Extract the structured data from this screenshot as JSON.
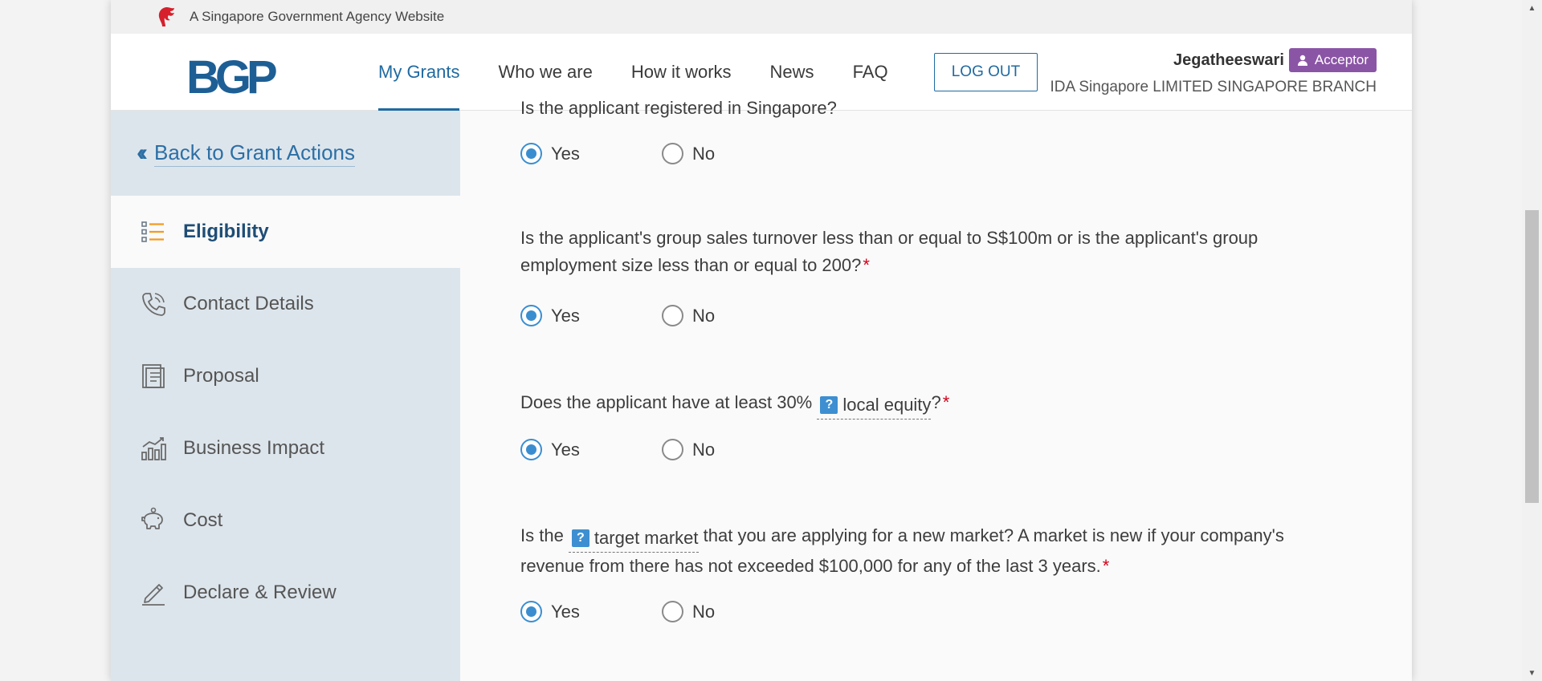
{
  "masthead": {
    "text": "A Singapore Government Agency Website"
  },
  "header": {
    "logo": "BGP",
    "nav": [
      {
        "label": "My Grants",
        "active": true
      },
      {
        "label": "Who we are",
        "active": false
      },
      {
        "label": "How it works",
        "active": false
      },
      {
        "label": "News",
        "active": false
      },
      {
        "label": "FAQ",
        "active": false
      }
    ],
    "logout_label": "LOG OUT",
    "user_name": "Jegatheeswari",
    "role": "Acceptor",
    "org": "IDA Singapore LIMITED SINGAPORE BRANCH"
  },
  "sidebar": {
    "back_label": "Back to Grant Actions",
    "items": [
      {
        "label": "Eligibility",
        "icon": "list-icon",
        "active": true
      },
      {
        "label": "Contact Details",
        "icon": "phone-icon",
        "active": false
      },
      {
        "label": "Proposal",
        "icon": "document-icon",
        "active": false
      },
      {
        "label": "Business Impact",
        "icon": "bar-chart-icon",
        "active": false
      },
      {
        "label": "Cost",
        "icon": "piggy-bank-icon",
        "active": false
      },
      {
        "label": "Declare & Review",
        "icon": "pen-icon",
        "active": false
      }
    ]
  },
  "main": {
    "q1": {
      "text": "Is the applicant registered in Singapore?"
    },
    "q2": {
      "text": "Is the applicant's group sales turnover less than or equal to S$100m or is the applicant's group employment size less than or equal to 200?"
    },
    "q3": {
      "prefix": "Does the applicant have at least 30% ",
      "tooltip": "local equity",
      "suffix": "?"
    },
    "q4": {
      "prefix": "Is the ",
      "tooltip": "target market",
      "suffix": " that you are applying for a new market? A market is new if your company's revenue from there has not exceeded $100,000 for any of the last 3 years."
    },
    "required_mark": "*",
    "tooltip_badge": "?",
    "yes_label": "Yes",
    "no_label": "No",
    "answers": [
      "Yes",
      "Yes",
      "Yes",
      "Yes"
    ]
  }
}
